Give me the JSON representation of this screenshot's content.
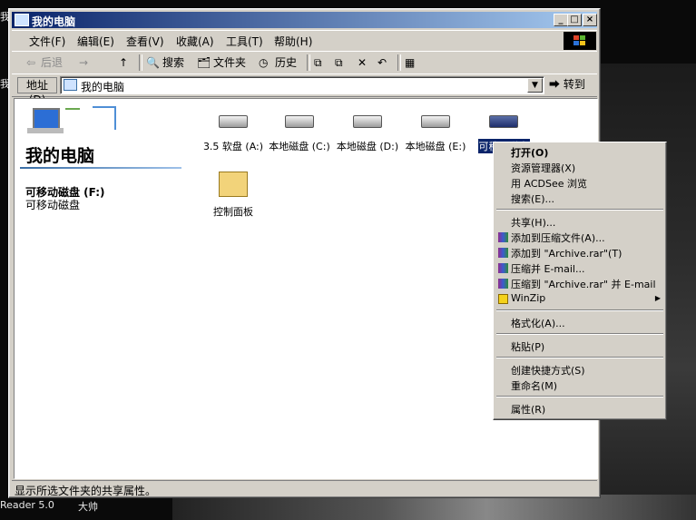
{
  "window": {
    "title": "我的电脑",
    "controls": {
      "minimize": "_",
      "maximize": "□",
      "close": "×"
    }
  },
  "menubar": [
    "文件(F)",
    "编辑(E)",
    "查看(V)",
    "收藏(A)",
    "工具(T)",
    "帮助(H)"
  ],
  "toolbar": {
    "back": "后退",
    "forward": "→",
    "up": "↑",
    "search": "搜索",
    "folders": "文件夹",
    "history": "历史",
    "views": "▦"
  },
  "address": {
    "label": "地址(D)",
    "value": "我的电脑",
    "go": "转到"
  },
  "sidebar": {
    "title": "我的电脑",
    "selected_name": "可移动磁盘 (F:)",
    "selected_type": "可移动磁盘"
  },
  "drives": [
    {
      "label": "3.5 软盘 (A:)"
    },
    {
      "label": "本地磁盘 (C:)"
    },
    {
      "label": "本地磁盘 (D:)"
    },
    {
      "label": "本地磁盘 (E:)"
    },
    {
      "label": "可移动磁盘"
    }
  ],
  "control_panel": {
    "label": "控制面板"
  },
  "status": "显示所选文件夹的共享属性。",
  "context_menu": {
    "open": "打开(O)",
    "explorer": "资源管理器(X)",
    "acdsee": "用 ACDSee 浏览",
    "search": "搜索(E)...",
    "share": "共享(H)...",
    "add_archive": "添加到压缩文件(A)...",
    "add_rar": "添加到 \"Archive.rar\"(T)",
    "compress_email": "压缩并 E-mail...",
    "compress_rar_email": "压缩到 \"Archive.rar\" 并 E-mail",
    "winzip": "WinZip",
    "format": "格式化(A)...",
    "paste": "粘贴(P)",
    "shortcut": "创建快捷方式(S)",
    "rename": "重命名(M)",
    "properties": "属性(R)"
  },
  "desktop_fragments": [
    "我",
    "我",
    "Reader 5.0",
    "大帅"
  ]
}
